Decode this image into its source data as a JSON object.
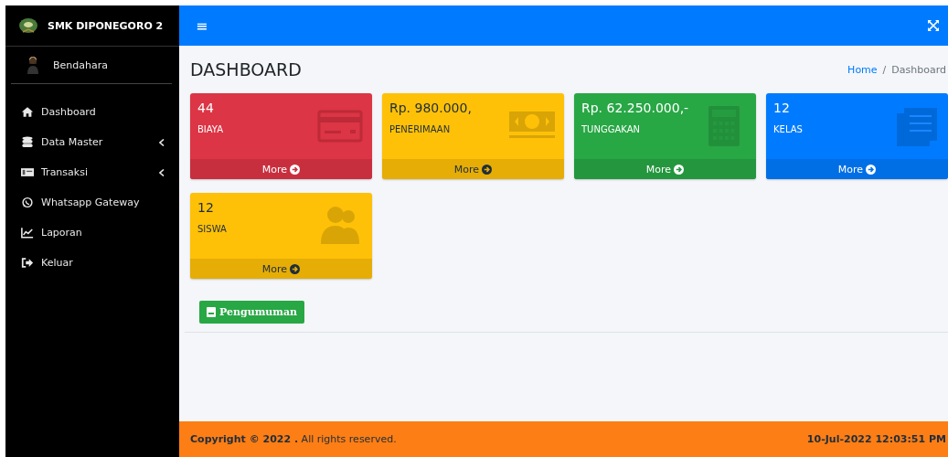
{
  "sidebar": {
    "brand": "SMK DIPONEGORO 2",
    "user": "Bendahara",
    "items": [
      {
        "label": "Dashboard",
        "expandable": false
      },
      {
        "label": "Data Master",
        "expandable": true
      },
      {
        "label": "Transaksi",
        "expandable": true
      },
      {
        "label": "Whatsapp Gateway",
        "expandable": false
      },
      {
        "label": "Laporan",
        "expandable": false
      },
      {
        "label": "Keluar",
        "expandable": false
      }
    ]
  },
  "topbar": {
    "menu": "≡"
  },
  "page": {
    "title": "DASHBOARD",
    "breadcrumb_separator": "/",
    "breadcrumb": [
      {
        "label": "Home",
        "selected": false
      },
      {
        "label": "Dashboard",
        "selected": true
      }
    ]
  },
  "cards": [
    {
      "kind": "danger",
      "value": "44",
      "label": "BIAYA",
      "more": "More"
    },
    {
      "kind": "warning",
      "value": "Rp. 980.000,",
      "label": "PENERIMAAN",
      "more": "More"
    },
    {
      "kind": "success",
      "value": "Rp. 62.250.000,-",
      "label": "TUNGGAKAN",
      "more": "More"
    },
    {
      "kind": "primary",
      "value": "12",
      "label": "KELAS",
      "more": "More"
    },
    {
      "kind": "warning",
      "value": "12",
      "label": "SISWA",
      "more": "More"
    }
  ],
  "announcement_button": "Pengumuman",
  "footer": {
    "copyright": "**Copyright © 2022 .** All rights reserved.",
    "datetime": "10-Jul-2022 12:03:51 PM"
  }
}
